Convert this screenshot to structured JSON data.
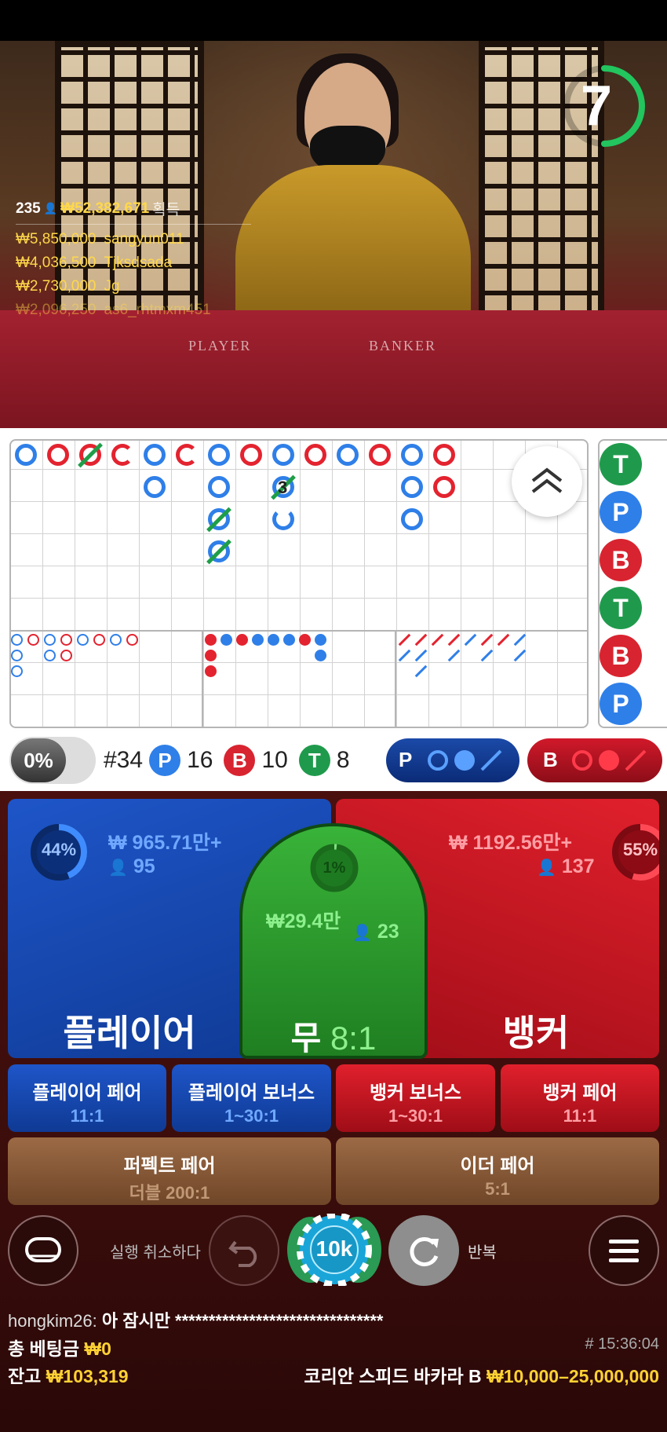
{
  "video": {
    "countdown": "7",
    "felt_player": "PLAYER",
    "felt_banker": "BANKER",
    "winners": {
      "count": "235",
      "total_amount": "₩52,382,671",
      "total_label": "획득",
      "rows": [
        {
          "amount": "₩5,850,000",
          "name": "sangyun011"
        },
        {
          "amount": "₩4,036,500",
          "name": "Tjksdsada"
        },
        {
          "amount": "₩2,730,000",
          "name": "Jg"
        },
        {
          "amount": "₩2,096,250",
          "name": "as6_rhtmxm451"
        }
      ]
    }
  },
  "roadmap": {
    "bead_number": "3",
    "side_results": [
      "T",
      "P",
      "B",
      "T",
      "B",
      "P"
    ]
  },
  "stats": {
    "percent": "0%",
    "round": "#34",
    "player_label": "P",
    "player_count": "16",
    "banker_label": "B",
    "banker_count": "10",
    "tie_label": "T",
    "tie_count": "8",
    "player_ask": "P",
    "banker_ask": "B"
  },
  "bets": {
    "player": {
      "title": "플레이어",
      "percent": "44%",
      "amount": "₩ 965.71만+",
      "players": "95"
    },
    "tie": {
      "title": "무",
      "odds": "8:1",
      "percent": "1%",
      "amount": "₩29.4만",
      "players": "23"
    },
    "banker": {
      "title": "뱅커",
      "percent": "55%",
      "amount": "₩ 1192.56만+",
      "players": "137"
    },
    "side": [
      {
        "title": "플레이어 페어",
        "odds": "11:1"
      },
      {
        "title": "플레이어 보너스",
        "odds": "1~30:1"
      },
      {
        "title": "뱅커 보너스",
        "odds": "1~30:1"
      },
      {
        "title": "뱅커 페어",
        "odds": "11:1"
      }
    ],
    "perfect_pair": {
      "title": "퍼펙트 페어",
      "odds": "더블 200:1"
    },
    "either_pair": {
      "title": "이더 페어",
      "odds": "5:1"
    }
  },
  "controls": {
    "undo_label": "실행 취소하다",
    "chip_value": "10k",
    "repeat_label": "반복"
  },
  "footer": {
    "chat_user": "hongkim26:",
    "chat_msg": "아 잠시만 *******************************",
    "total_bet_label": "총 베팅금",
    "total_bet_value": "₩0",
    "balance_label": "잔고",
    "balance_value": "₩103,319",
    "time": "# 15:36:04",
    "table_name": "코리안 스피드 바카라 B",
    "table_limits": "₩10,000–25,000,000"
  },
  "colors": {
    "player_blue": "#1e55c8",
    "banker_red": "#e0202c",
    "tie_green": "#39b339",
    "gold_text": "#ffd233"
  }
}
